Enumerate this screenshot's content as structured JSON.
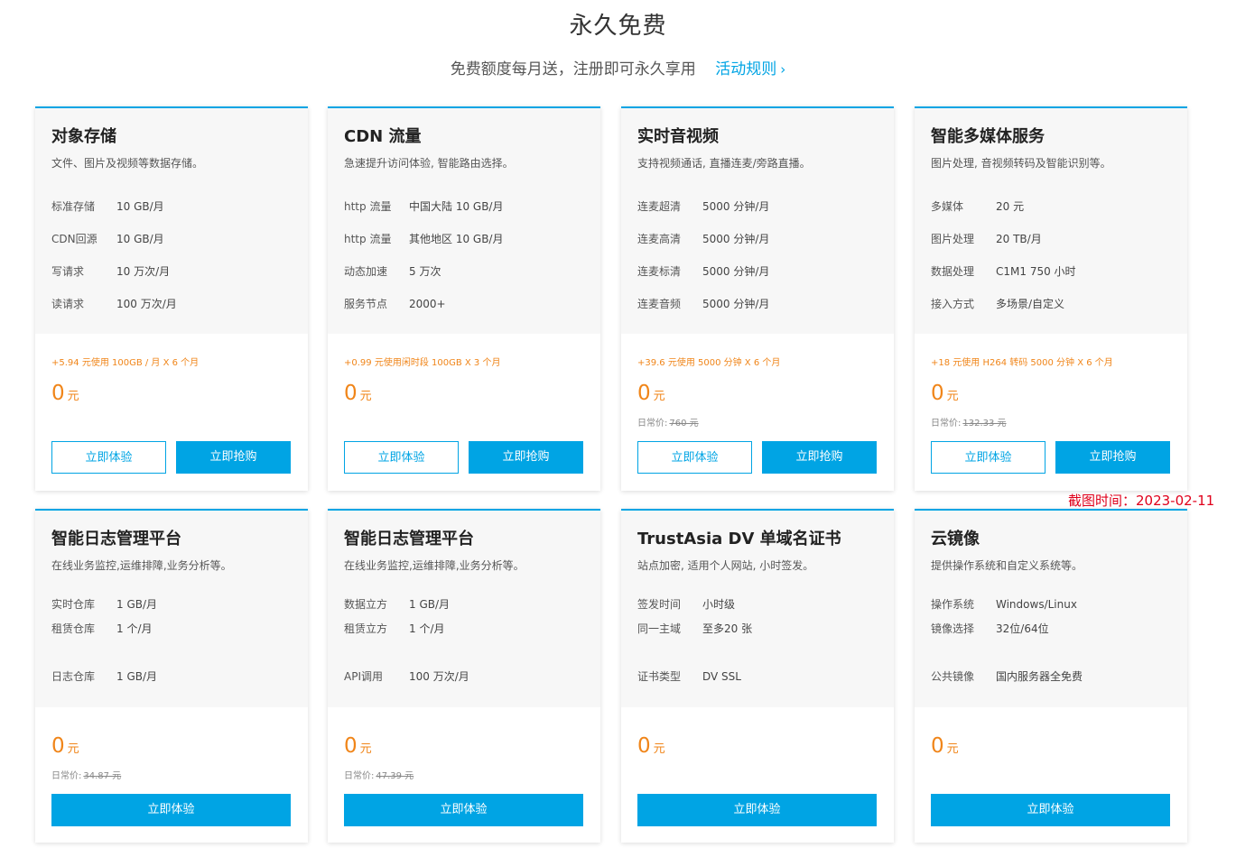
{
  "header": {
    "title": "永久免费",
    "subtitle": "免费额度每月送，注册即可永久享用",
    "rules_link": "活动规则",
    "rules_chevron": "›"
  },
  "stamp": "截图时间：2023-02-11",
  "accent_color": "#00a4e4",
  "price_color": "#f08519",
  "cards_row1": [
    {
      "name": "对象存储",
      "desc": "文件、图片及视频等数据存储。",
      "specs": [
        {
          "k": "标准存储",
          "v": "10 GB/月"
        },
        {
          "k": "CDN回源",
          "v": "10 GB/月"
        },
        {
          "k": "写请求",
          "v": "10 万次/月"
        },
        {
          "k": "读请求",
          "v": "100 万次/月"
        }
      ],
      "promo": "+5.94 元使用 100GB / 月 X 6 个月",
      "price": "0",
      "unit": "元",
      "orig_label": "",
      "orig_value": "",
      "btn_try": "立即体验",
      "btn_buy": "立即抢购"
    },
    {
      "name": "CDN 流量",
      "desc": "急速提升访问体验, 智能路由选择。",
      "specs": [
        {
          "k": "http 流量",
          "v": "中国大陆 10 GB/月"
        },
        {
          "k": "http 流量",
          "v": "其他地区 10 GB/月"
        },
        {
          "k": "动态加速",
          "v": "5 万次"
        },
        {
          "k": "服务节点",
          "v": "2000+"
        }
      ],
      "promo": "+0.99 元使用闲时段 100GB X 3 个月",
      "price": "0",
      "unit": "元",
      "orig_label": "",
      "orig_value": "",
      "btn_try": "立即体验",
      "btn_buy": "立即抢购"
    },
    {
      "name": "实时音视频",
      "desc": "支持视频通话, 直播连麦/旁路直播。",
      "specs": [
        {
          "k": "连麦超清",
          "v": "5000 分钟/月"
        },
        {
          "k": "连麦高清",
          "v": "5000 分钟/月"
        },
        {
          "k": "连麦标清",
          "v": "5000 分钟/月"
        },
        {
          "k": "连麦音频",
          "v": "5000 分钟/月"
        }
      ],
      "promo": "+39.6 元使用 5000 分钟 X 6 个月",
      "price": "0",
      "unit": "元",
      "orig_label": "日常价:",
      "orig_value": "760 元",
      "btn_try": "立即体验",
      "btn_buy": "立即抢购"
    },
    {
      "name": "智能多媒体服务",
      "desc": "图片处理, 音视频转码及智能识别等。",
      "specs": [
        {
          "k": "多媒体",
          "v": "20 元"
        },
        {
          "k": "图片处理",
          "v": "20 TB/月"
        },
        {
          "k": "数据处理",
          "v": "C1M1 750 小时"
        },
        {
          "k": "接入方式",
          "v": "多场景/自定义"
        }
      ],
      "promo": "+18 元使用 H264 转码 5000 分钟 X 6 个月",
      "price": "0",
      "unit": "元",
      "orig_label": "日常价:",
      "orig_value": "132.33 元",
      "btn_try": "立即体验",
      "btn_buy": "立即抢购"
    }
  ],
  "cards_row2": [
    {
      "name": "智能日志管理平台",
      "desc": "在线业务监控,运维排障,业务分析等。",
      "specs": [
        {
          "k": "实时仓库",
          "v": "1 GB/月"
        },
        {
          "k": "租赁仓库",
          "v": "1 个/月"
        },
        {
          "k": "日志仓库",
          "v": "1 GB/月"
        }
      ],
      "price": "0",
      "unit": "元",
      "orig_label": "日常价:",
      "orig_value": "34.87 元",
      "btn_try": "立即体验"
    },
    {
      "name": "智能日志管理平台",
      "desc": "在线业务监控,运维排障,业务分析等。",
      "specs": [
        {
          "k": "数据立方",
          "v": "1 GB/月"
        },
        {
          "k": "租赁立方",
          "v": "1 个/月"
        },
        {
          "k": "API调用",
          "v": "100 万次/月"
        }
      ],
      "price": "0",
      "unit": "元",
      "orig_label": "日常价:",
      "orig_value": "47.39 元",
      "btn_try": "立即体验"
    },
    {
      "name": "TrustAsia DV 单域名证书",
      "desc": "站点加密, 适用个人网站, 小时签发。",
      "specs": [
        {
          "k": "签发时间",
          "v": "小时级"
        },
        {
          "k": "同一主域",
          "v": "至多20 张"
        },
        {
          "k": "证书类型",
          "v": "DV SSL"
        }
      ],
      "price": "0",
      "unit": "元",
      "orig_label": "",
      "orig_value": "",
      "btn_try": "立即体验"
    },
    {
      "name": "云镜像",
      "desc": "提供操作系统和自定义系统等。",
      "specs": [
        {
          "k": "操作系统",
          "v": "Windows/Linux"
        },
        {
          "k": "镜像选择",
          "v": "32位/64位"
        },
        {
          "k": "公共镜像",
          "v": "国内服务器全免费"
        }
      ],
      "price": "0",
      "unit": "元",
      "orig_label": "",
      "orig_value": "",
      "btn_try": "立即体验"
    }
  ]
}
